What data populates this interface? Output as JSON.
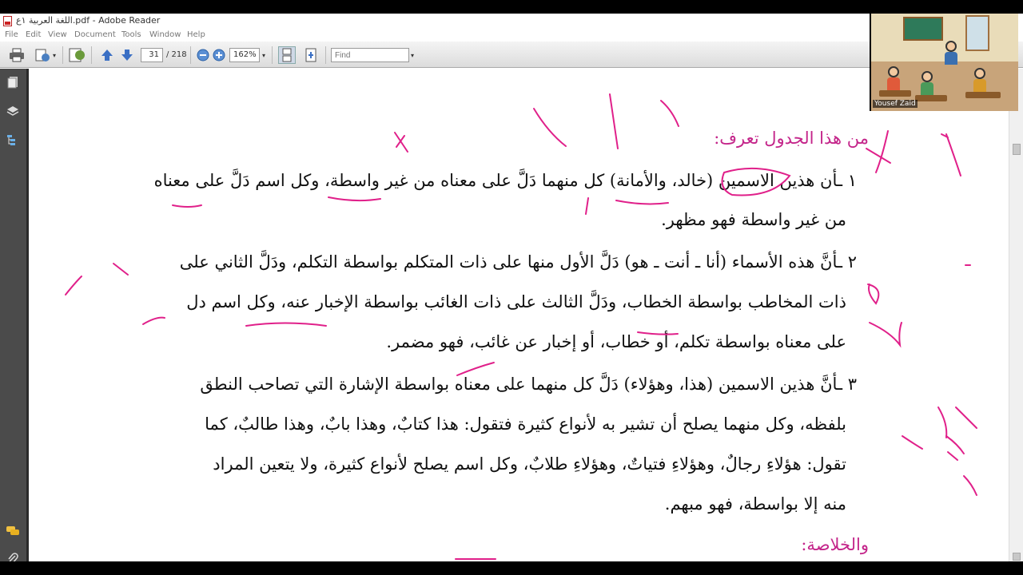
{
  "window": {
    "title": "اللغة العربية ١ع.pdf - Adobe Reader"
  },
  "menu": [
    "File",
    "Edit",
    "View",
    "Document",
    "Tools",
    "Window",
    "Help"
  ],
  "toolbar": {
    "page_current": "31",
    "page_total": "/ 218",
    "zoom": "162%",
    "find_placeholder": "Find"
  },
  "left_panel_icons": [
    "pages-icon",
    "layers-icon",
    "bookmarks-icon",
    "comments-icon",
    "attachments-icon"
  ],
  "document": {
    "heading1": "من هذا الجدول تعرف:",
    "p1_line1": "١ ـأن هذين الاسمين (خالد، والأمانة) كل منهما دَلَّ على معناه من غير واسطة، وكل اسم دَلَّ على معناه",
    "p1_line2": "من غير واسطة فهو مظهر.",
    "p2_line1": "٢ ـأنَّ هذه الأسماء (أنا ـ أنت ـ هو) دَلَّ الأول منها على ذات المتكلم بواسطة التكلم، ودَلَّ الثاني على",
    "p2_line2": "ذات المخاطب بواسطة الخطاب، ودَلَّ الثالث على ذات الغائب بواسطة الإخبار عنه، وكل اسم دل",
    "p2_line3": "على معناه بواسطة تكلم، أو خطاب، أو إخبار عن غائب، فهو مضمر.",
    "p3_line1": "٣ ـأنَّ هذين الاسمين (هذا، وهؤلاء) دَلَّ كل منهما على معناه بواسطة الإشارة التي تصاحب النطق",
    "p3_line2": "بلفظه، وكل منهما يصلح أن تشير به لأنواع كثيرة فتقول: هذا كتابٌ، وهذا بابٌ، وهذا طالبٌ، كما",
    "p3_line3": "تقول: هؤلاءِ رجالٌ، وهؤلاءِ فتياتٌ، وهؤلاءِ طلابٌ، وكل اسم يصلح لأنواع كثيرة، ولا يتعين المراد",
    "p3_line4": "منه إلا بواسطة، فهو مبهم.",
    "heading2": "والخلاصة:"
  },
  "webcam": {
    "name": "Yousef Zaid"
  },
  "colors": {
    "heading": "#c4258a",
    "ink": "#e0208a",
    "panel": "#4b4b4b"
  }
}
